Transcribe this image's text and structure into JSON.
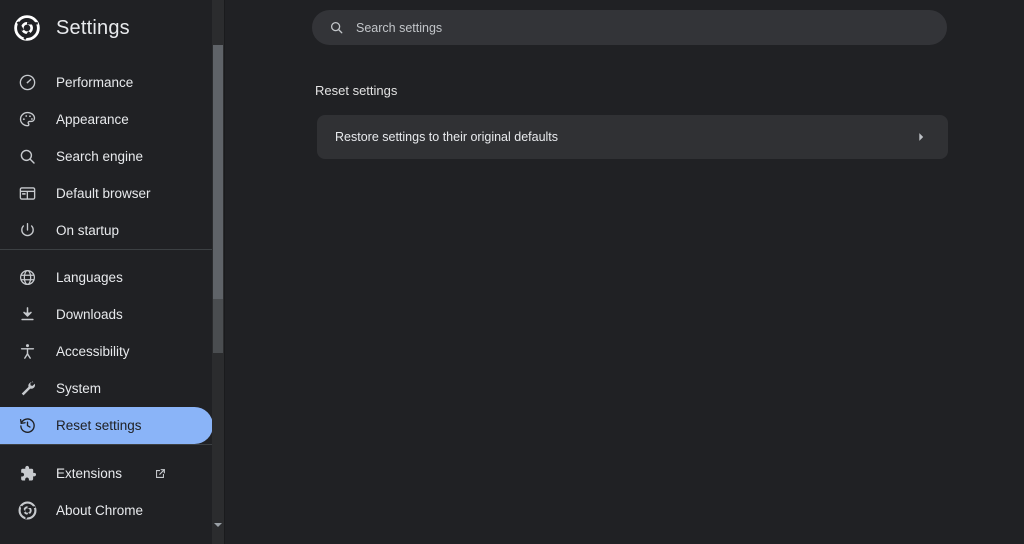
{
  "window": {
    "background": "#202124"
  },
  "sidebar": {
    "brand": {
      "title": "Settings",
      "logo_icon": "chrome-logo-icon"
    },
    "groups": [
      {
        "items": [
          {
            "label": "Performance",
            "icon": "speedometer-icon",
            "selected": false
          },
          {
            "label": "Appearance",
            "icon": "palette-icon",
            "selected": false
          },
          {
            "label": "Search engine",
            "icon": "search-icon",
            "selected": false
          },
          {
            "label": "Default browser",
            "icon": "browser-window-icon",
            "selected": false
          },
          {
            "label": "On startup",
            "icon": "power-icon",
            "selected": false
          }
        ]
      },
      {
        "items": [
          {
            "label": "Languages",
            "icon": "globe-icon",
            "selected": false
          },
          {
            "label": "Downloads",
            "icon": "download-icon",
            "selected": false
          },
          {
            "label": "Accessibility",
            "icon": "accessibility-icon",
            "selected": false
          },
          {
            "label": "System",
            "icon": "wrench-icon",
            "selected": false
          },
          {
            "label": "Reset settings",
            "icon": "history-restore-icon",
            "selected": true
          }
        ]
      },
      {
        "items": [
          {
            "label": "Extensions",
            "icon": "puzzle-piece-icon",
            "selected": false,
            "external": true,
            "external_icon": "external-link-icon"
          },
          {
            "label": "About Chrome",
            "icon": "chrome-logo-icon",
            "selected": false
          }
        ]
      }
    ],
    "selected_item": "Reset settings",
    "selected_color": "#8ab4f8",
    "scrollbar": {
      "up_icon": "scroll-up-arrow-icon",
      "down_icon": "scroll-down-arrow-icon"
    }
  },
  "search": {
    "placeholder": "Search settings",
    "value": "",
    "icon": "search-icon"
  },
  "main": {
    "section_title": "Reset settings",
    "cards": [
      {
        "label": "Restore settings to their original defaults",
        "chevron_icon": "chevron-right-icon"
      }
    ]
  }
}
